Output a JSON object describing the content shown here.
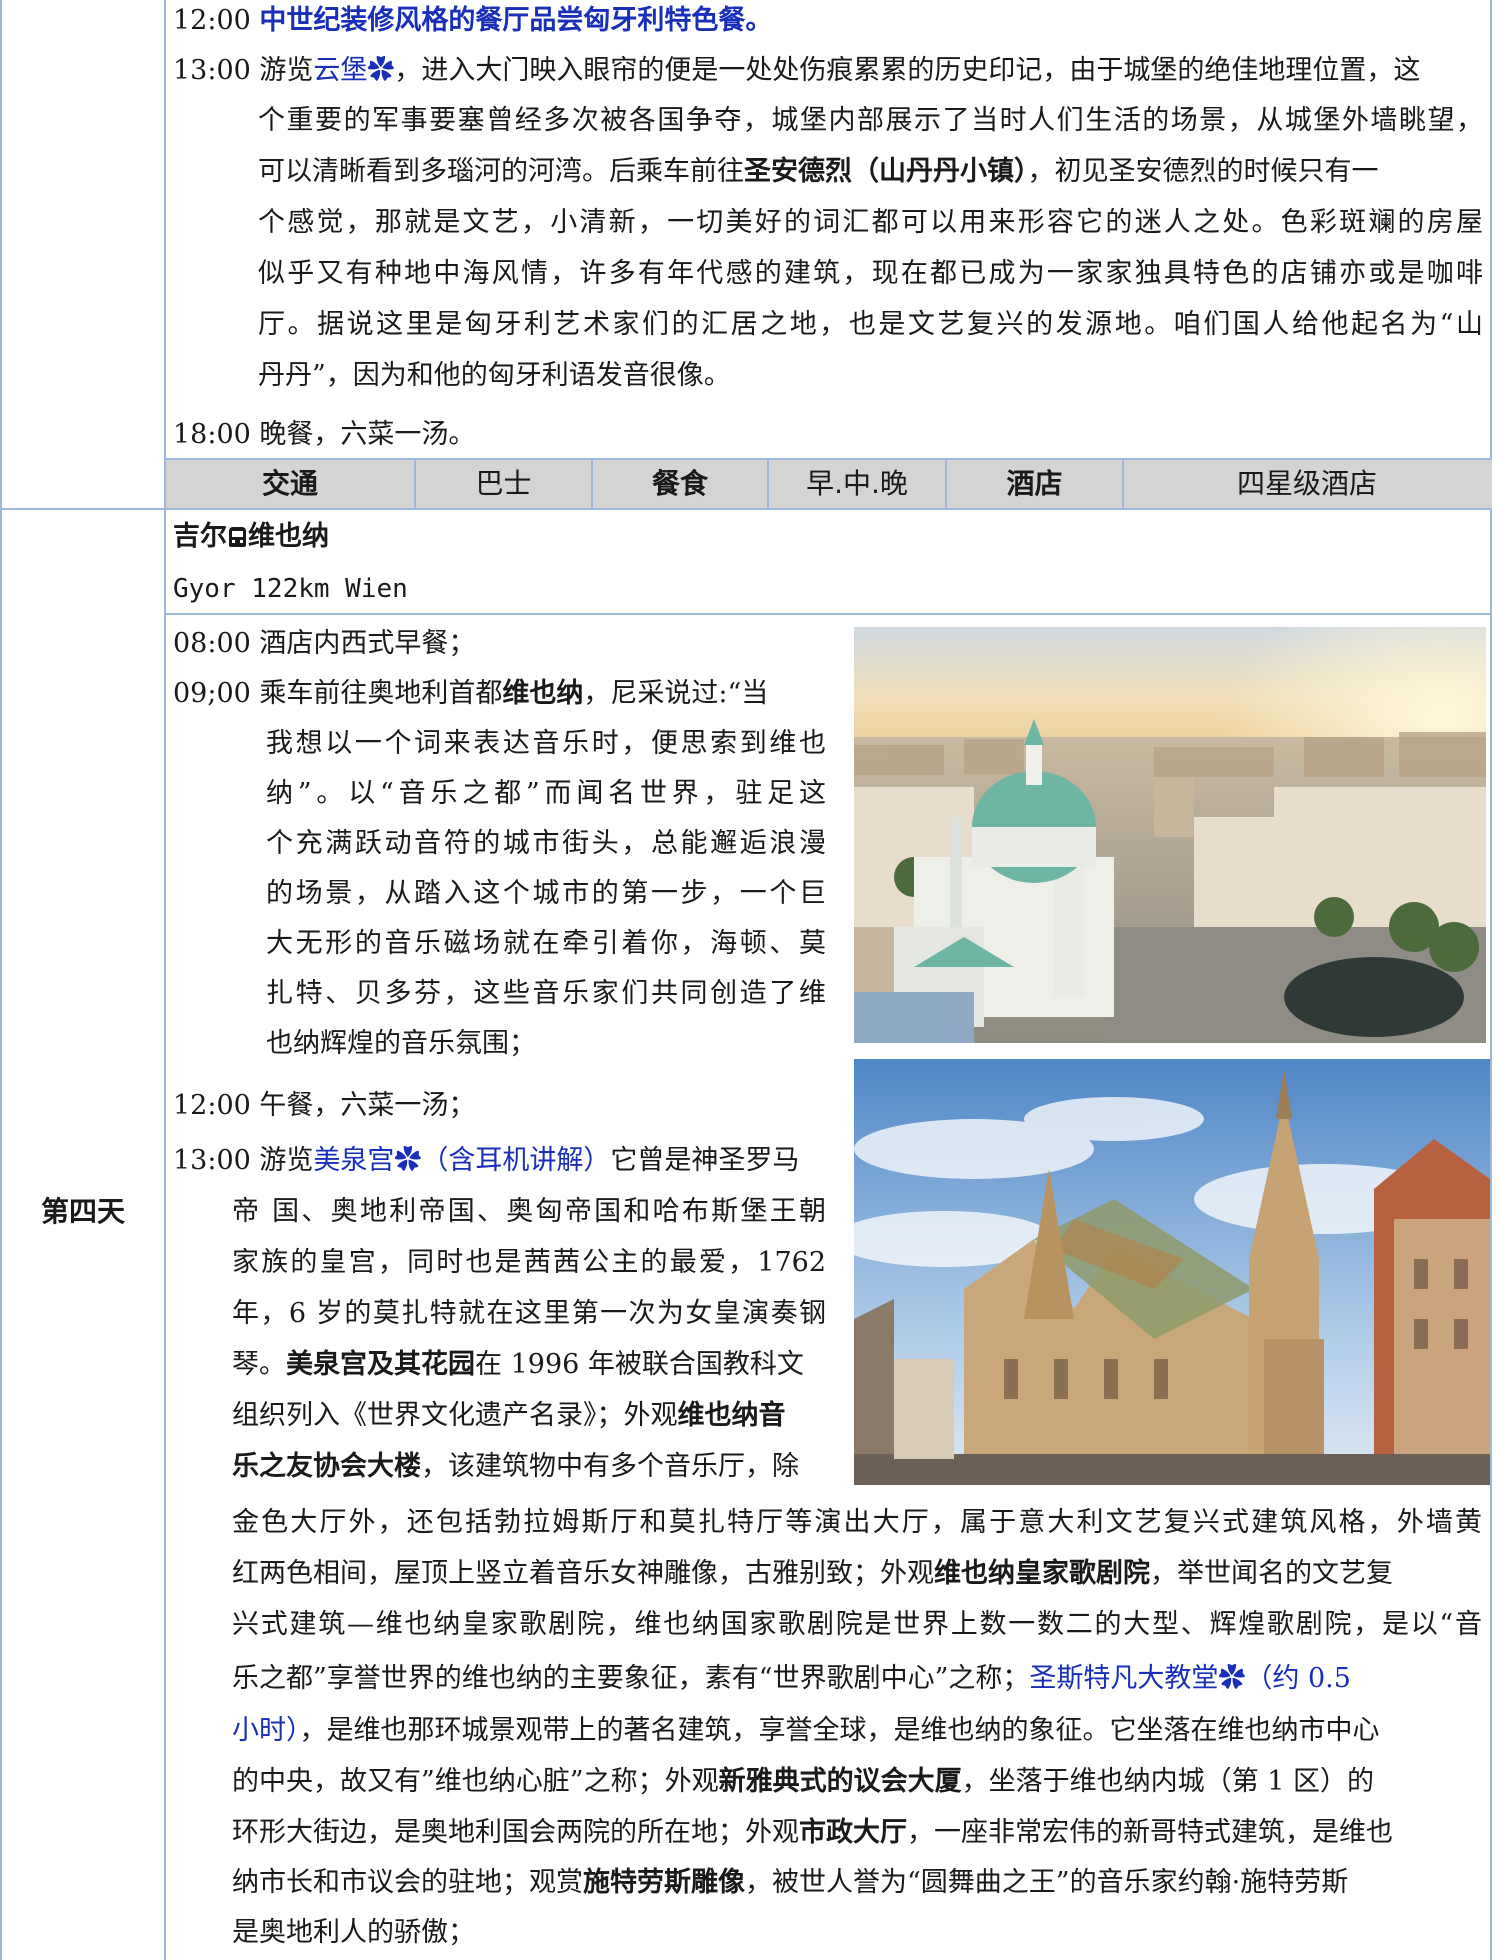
{
  "day3": {
    "l1_time": "12:00",
    "l1_text": "中世纪装修风格的餐厅品尝匈牙利特色餐。",
    "l2_time": "13:00",
    "l2_pre": "游览",
    "l2_link": "云堡",
    "l2_post": "，进入大门映入眼帘的便是一处处伤痕累累的历史印记，由于城堡的绝佳地理位置，这",
    "p2": "个重要的军事要塞曾经多次被各国争夺，城堡内部展示了当时人们生活的场景，从城堡外墙眺望，",
    "p3a": "可以清晰看到多瑙河的河湾。后乘车前往",
    "p3b": "圣安德烈（山丹丹小镇）",
    "p3c": "，初见圣安德烈的时候只有一",
    "p4": "个感觉，那就是文艺，小清新，一切美好的词汇都可以用来形容它的迷人之处。色彩斑斓的房屋",
    "p5": "似乎又有种地中海风情，许多有年代感的建筑，现在都已成为一家家独具特色的店铺亦或是咖啡",
    "p6": "厅。据说这里是匈牙利艺术家们的汇居之地，也是文艺复兴的发源地。咱们国人给他起名为“山",
    "p7": "丹丹”，因为和他的匈牙利语发音很像。",
    "l3_time": "18:00",
    "l3_text": "晚餐，六菜一汤。"
  },
  "info_row": {
    "transport_label": "交通",
    "transport_value": "巴士",
    "meal_label": "餐食",
    "meal_value": "早.中.晚",
    "hotel_label": "酒店",
    "hotel_value": "四星级酒店"
  },
  "day4": {
    "day_label": "第四天",
    "route_from": "吉尔",
    "route_to": "维也纳",
    "route_distance": "Gyor 122km Wien",
    "s1_time": "08:00",
    "s1_text": "酒店内西式早餐；",
    "s2_time": "09;00",
    "s2_pre": "乘车前往奥地利首都",
    "s2_bold": "维也纳",
    "s2_post": "，尼采说过:“当",
    "s2_l2": "我想以一个词来表达音乐时，便思索到维也",
    "s2_l3": "纳”。以“音乐之都”而闻名世界，驻足这",
    "s2_l4": "个充满跃动音符的城市街头，总能邂逅浪漫",
    "s2_l5": "的场景，从踏入这个城市的第一步，一个巨",
    "s2_l6": "大无形的音乐磁场就在牵引着你，海顿、莫",
    "s2_l7": "扎特、贝多芬，这些音乐家们共同创造了维",
    "s2_l8": "也纳辉煌的音乐氛围；",
    "s3_time": "12:00",
    "s3_text": "午餐，六菜一汤；",
    "s4_time": "13:00",
    "s4_pre": "游览",
    "s4_link": "美泉宫",
    "s4_link2": "（含耳机讲解）",
    "s4_post": "它曾是神圣罗马",
    "s4_l2": "帝 国、奥地利帝国、奥匈帝国和哈布斯堡王朝",
    "s4_l3": "家族的皇宫，同时也是茜茜公主的最爱，1762",
    "s4_l4": "年，6 岁的莫扎特就在这里第一次为女皇演奏钢",
    "s4_l5a": "琴。",
    "s4_l5b": "美泉宫及其花园",
    "s4_l5c": "在 1996 年被联合国教科文",
    "s4_l6a": "组织列入《世界文化遗产名录》；外观",
    "s4_l6b": "维也纳音",
    "s4_l7a": "乐之友协会大楼",
    "s4_l7b": "，该建筑物中有多个音乐厅，除",
    "w1": "金色大厅外，还包括勃拉姆斯厅和莫扎特厅等演出大厅，属于意大利文艺复兴式建筑风格，外墙黄",
    "w2a": "红两色相间，屋顶上竖立着音乐女神雕像，古雅别致；外观",
    "w2b": "维也纳皇家歌剧院",
    "w2c": "，举世闻名的文艺复",
    "w3": "兴式建筑—维也纳皇家歌剧院，维也纳国家歌剧院是世界上数一数二的大型、辉煌歌剧院，是以“音",
    "w4a": "乐之都”享誉世界的维也纳的主要象征，素有“世界歌剧中心”之称；",
    "w4b": "圣斯特凡大教堂",
    "w4c": "（约 0.5",
    "w5a": "小时）",
    "w5b": "，是维也那环城景观带上的著名建筑，享誉全球，是维也纳的象征。它坐落在维也纳市中心",
    "w6": "的中央，故又有”维也纳心脏”之称；外观",
    "w6b": "新雅典式的议会大厦",
    "w6c": "，坐落于维也纳内城（第 1 区）的",
    "w7a": "环形大街边，是奥地利国会两院的所在地；外观",
    "w7b": "市政大厅",
    "w7c": "，一座非常宏伟的新哥特式建筑，是维也",
    "w8a": "纳市长和市议会的驻地；观赏",
    "w8b": "施特劳斯雕像",
    "w8c": "，被世人誉为“圆舞曲之王”的音乐家约翰·施特劳斯",
    "w9": "是奥地利人的骄傲；"
  },
  "colors": {
    "border": "#9db8d8",
    "link": "#1a2fb8",
    "header_bg": "#d4d4d4"
  },
  "icons": {
    "attraction": "flower-icon",
    "transport": "bus-icon"
  },
  "images": {
    "photo1": "vienna-karlskirche-aerial-photo",
    "photo2": "st-stephens-cathedral-photo"
  }
}
